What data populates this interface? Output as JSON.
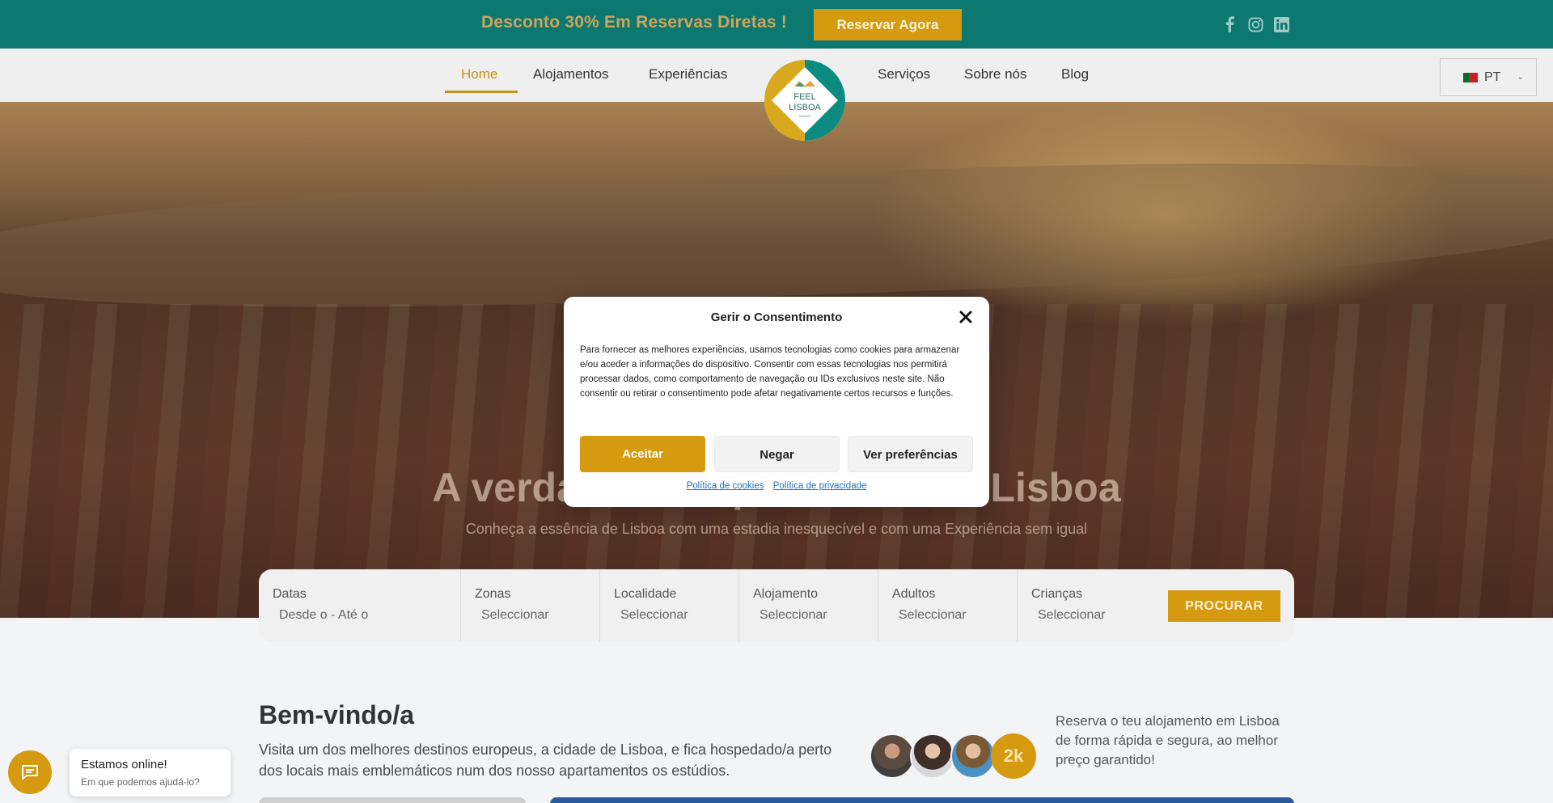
{
  "topbar": {
    "promo_text": "Desconto 30% Em Reservas Diretas !",
    "cta_label": "Reservar Agora",
    "socials": [
      "facebook-icon",
      "instagram-icon",
      "linkedin-icon"
    ]
  },
  "nav": {
    "items": [
      {
        "label": "Home",
        "active": true
      },
      {
        "label": "Alojamentos"
      },
      {
        "label": "Experiências"
      },
      {
        "label": "Serviços"
      },
      {
        "label": "Sobre nós"
      },
      {
        "label": "Blog"
      }
    ],
    "logo": {
      "line1": "FEEL",
      "line2": "LISBOA"
    },
    "language": "PT"
  },
  "hero": {
    "title": "A verdadeira experiência em Lisboa",
    "subtitle": "Conheça a essência de Lisboa com uma estadia inesquecível e com uma Experiência sem igual"
  },
  "search": {
    "fields": [
      {
        "label": "Datas",
        "value": "Desde o - Até o"
      },
      {
        "label": "Zonas",
        "value": "Seleccionar"
      },
      {
        "label": "Localidade",
        "value": "Seleccionar"
      },
      {
        "label": "Alojamento",
        "value": "Seleccionar"
      },
      {
        "label": "Adultos",
        "value": "Seleccionar"
      },
      {
        "label": "Crianças",
        "value": "Seleccionar"
      }
    ],
    "button_label": "PROCURAR"
  },
  "welcome": {
    "title": "Bem-vindo/a",
    "text": "Visita um dos melhores destinos europeus, a cidade de Lisboa, e fica hospedado/a perto dos locais mais emblemáticos num dos nosso apartamentos os estúdios.",
    "count": "2k",
    "booking_text": "Reserva o teu alojamento em Lisboa de forma rápida e segura, ao melhor preço garantido!"
  },
  "chat": {
    "title": "Estamos online!",
    "subtitle": "Em que podemos ajudá-lo?"
  },
  "consent": {
    "title": "Gerir o Consentimento",
    "text": "Para fornecer as melhores experiências, usamos tecnologias como cookies para armazenar e/ou aceder a informações do dispositivo. Consentir com essas tecnologias nos permitirá processar dados, como comportamento de navegação ou IDs exclusivos neste site. Não consentir ou retirar o consentimento pode afetar negativamente certos recursos e funções.",
    "accept_label": "Aceitar",
    "deny_label": "Negar",
    "prefs_label": "Ver preferências",
    "cookie_policy": "Política de cookies",
    "privacy_policy": "Política de privacidade"
  },
  "colors": {
    "teal": "#0c7870",
    "accent": "#d59a10",
    "nav_active": "#c7901a"
  }
}
